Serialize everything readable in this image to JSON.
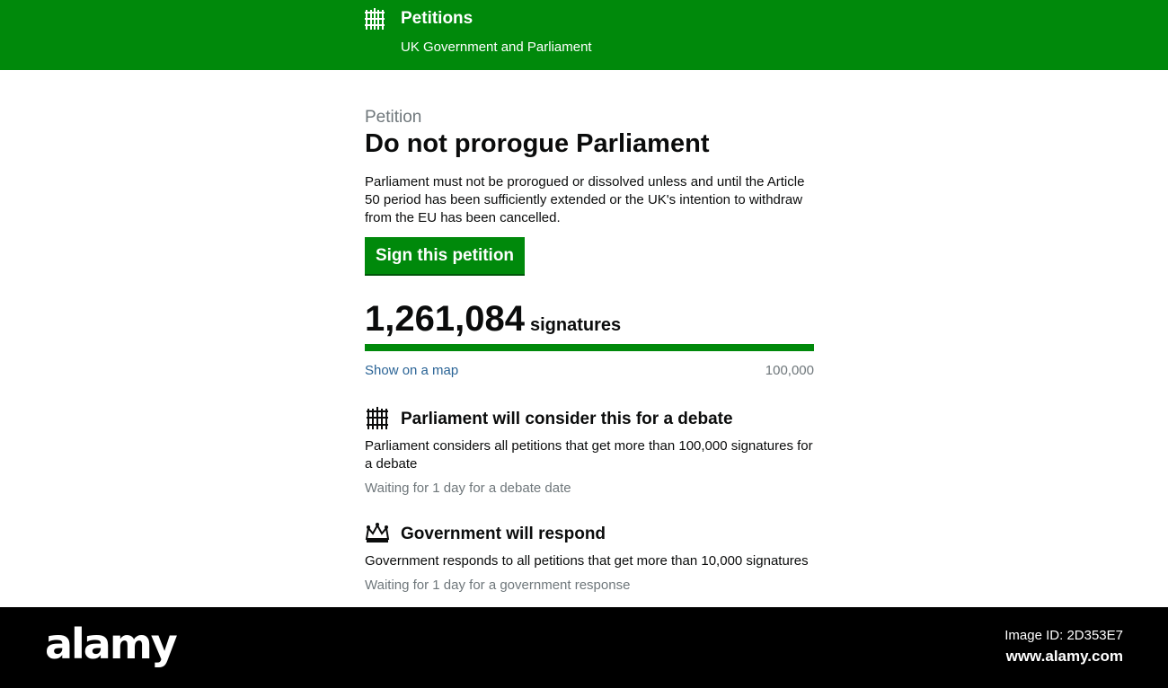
{
  "header": {
    "title": "Petitions",
    "subtitle": "UK Government and Parliament",
    "logo_icon": "portcullis-icon",
    "background": "#00890b"
  },
  "petition": {
    "kicker": "Petition",
    "title": "Do not prorogue Parliament",
    "description": "Parliament must not be prorogued or dissolved unless and until the Article 50 period has been sufficiently extended or the UK's intention to withdraw from the EU has been cancelled.",
    "sign_label": "Sign this petition"
  },
  "signatures": {
    "count": "1,261,084",
    "label": "signatures",
    "progress_fraction": 1.0,
    "map_link": "Show on a map",
    "threshold": "100,000"
  },
  "sections": [
    {
      "icon": "portcullis-icon",
      "title": "Parliament will consider this for a debate",
      "text": "Parliament considers all petitions that get more than 100,000 signatures for a debate",
      "status": "Waiting for 1 day for a debate date"
    },
    {
      "icon": "crown-icon",
      "title": "Government will respond",
      "text": "Government responds to all petitions that get more than 10,000 signatures",
      "status": "Waiting for 1 day for a government response"
    }
  ],
  "footer": {
    "brand": "alamy",
    "image_id": "Image ID: 2D353E7",
    "url": "www.alamy.com"
  }
}
